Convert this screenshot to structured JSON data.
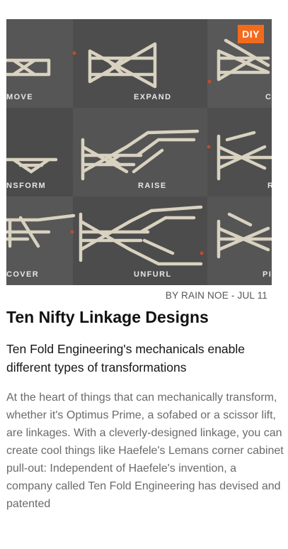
{
  "article": {
    "badge": "DIY",
    "tile_labels": [
      "MOVE",
      "EXPAND",
      "C",
      "NSFORM",
      "RAISE",
      "R",
      "COVER",
      "UNFURL",
      "PI"
    ],
    "byline_author_prefix": "BY RAIN NOE",
    "byline_separator": " - ",
    "byline_date": "JUL 11",
    "title": "Ten Nifty Linkage Designs",
    "subtitle": "Ten Fold Engineering's mechanicals enable different types of transformations",
    "excerpt": "At the heart of things that can mechanically transform, whether it's Optimus Prime, a sofabed or a scissor lift, are linkages. With a cleverly-designed linkage, you can create cool things like Haefele's Lemans corner cabinet pull-out: Independent of Haefele's invention, a company called Ten Fold Engineering has devised and patented"
  },
  "colors": {
    "badge_bg": "#f26b1d",
    "image_bg": "#4f4f4f",
    "linkage_stroke": "#d9d2c0",
    "text_dark": "#111111",
    "text_muted": "#6a6a6a"
  }
}
